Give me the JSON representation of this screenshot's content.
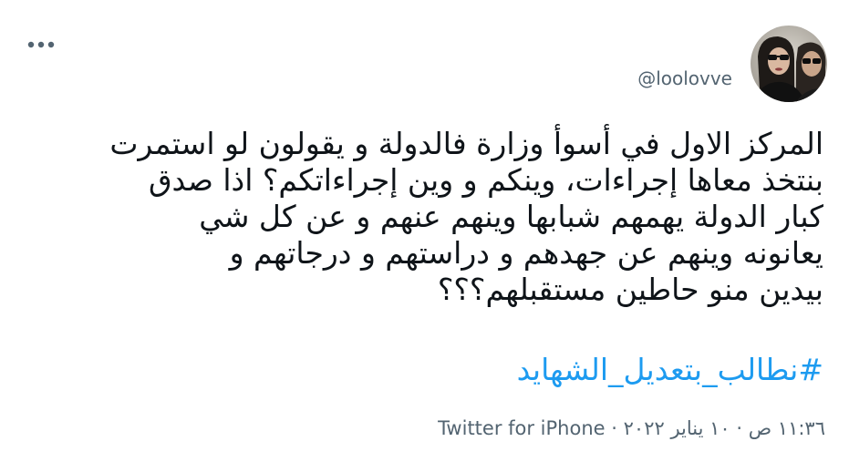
{
  "tweet": {
    "handle": "@loolovve",
    "body_lines": [
      "المركز الاول في أسوأ وزارة فالدولة و يقولون لو استمرت",
      "بنتخذ معاها إجراءات، وينكم و وين إجراءاتكم؟ اذا صدق",
      "كبار الدولة يهمهم شبابها وينهم عنهم و عن كل شي",
      "يعانونه وينهم عن جهدهم و دراستهم و درجاتهم و",
      "بيدين منو حاطين مستقبلهم؟؟؟"
    ],
    "hashtag": "#نطالب_بتعديل_الشهايد",
    "timestamp": "١١:٣٦ ص · ١٠ يناير ٢٠٢٢",
    "separator": "·",
    "source": "Twitter for iPhone"
  },
  "icons": {
    "more": "more-horizontal-icon",
    "avatar": "profile-photo"
  },
  "colors": {
    "text": "#0f1419",
    "secondary": "#536471",
    "link": "#1d9bf0"
  }
}
